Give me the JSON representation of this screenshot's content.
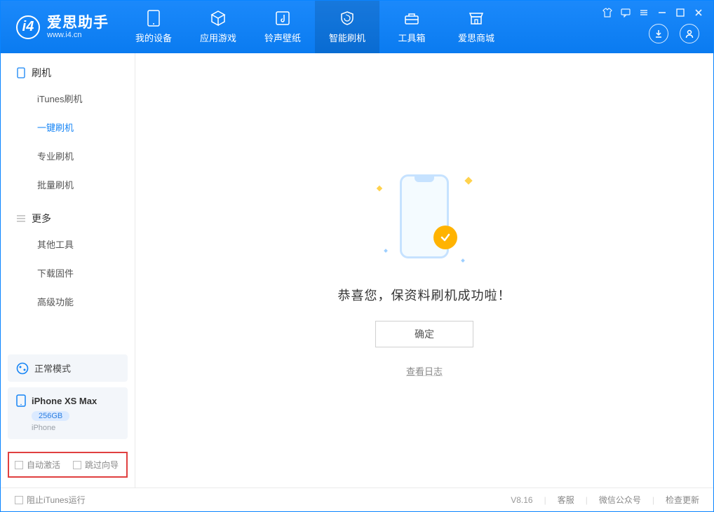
{
  "app": {
    "title": "爱思助手",
    "subtitle": "www.i4.cn"
  },
  "nav": {
    "items": [
      {
        "label": "我的设备"
      },
      {
        "label": "应用游戏"
      },
      {
        "label": "铃声壁纸"
      },
      {
        "label": "智能刷机"
      },
      {
        "label": "工具箱"
      },
      {
        "label": "爱思商城"
      }
    ]
  },
  "sidebar": {
    "section_flash": "刷机",
    "items_flash": [
      {
        "label": "iTunes刷机"
      },
      {
        "label": "一键刷机"
      },
      {
        "label": "专业刷机"
      },
      {
        "label": "批量刷机"
      }
    ],
    "section_more": "更多",
    "items_more": [
      {
        "label": "其他工具"
      },
      {
        "label": "下载固件"
      },
      {
        "label": "高级功能"
      }
    ],
    "mode_label": "正常模式",
    "device_name": "iPhone XS Max",
    "device_capacity": "256GB",
    "device_type": "iPhone",
    "chk_auto_activate": "自动激活",
    "chk_skip_guide": "跳过向导"
  },
  "main": {
    "success_message": "恭喜您，保资料刷机成功啦！",
    "ok_button": "确定",
    "view_log": "查看日志"
  },
  "footer": {
    "block_itunes": "阻止iTunes运行",
    "version": "V8.16",
    "support": "客服",
    "wechat": "微信公众号",
    "check_update": "检查更新"
  }
}
